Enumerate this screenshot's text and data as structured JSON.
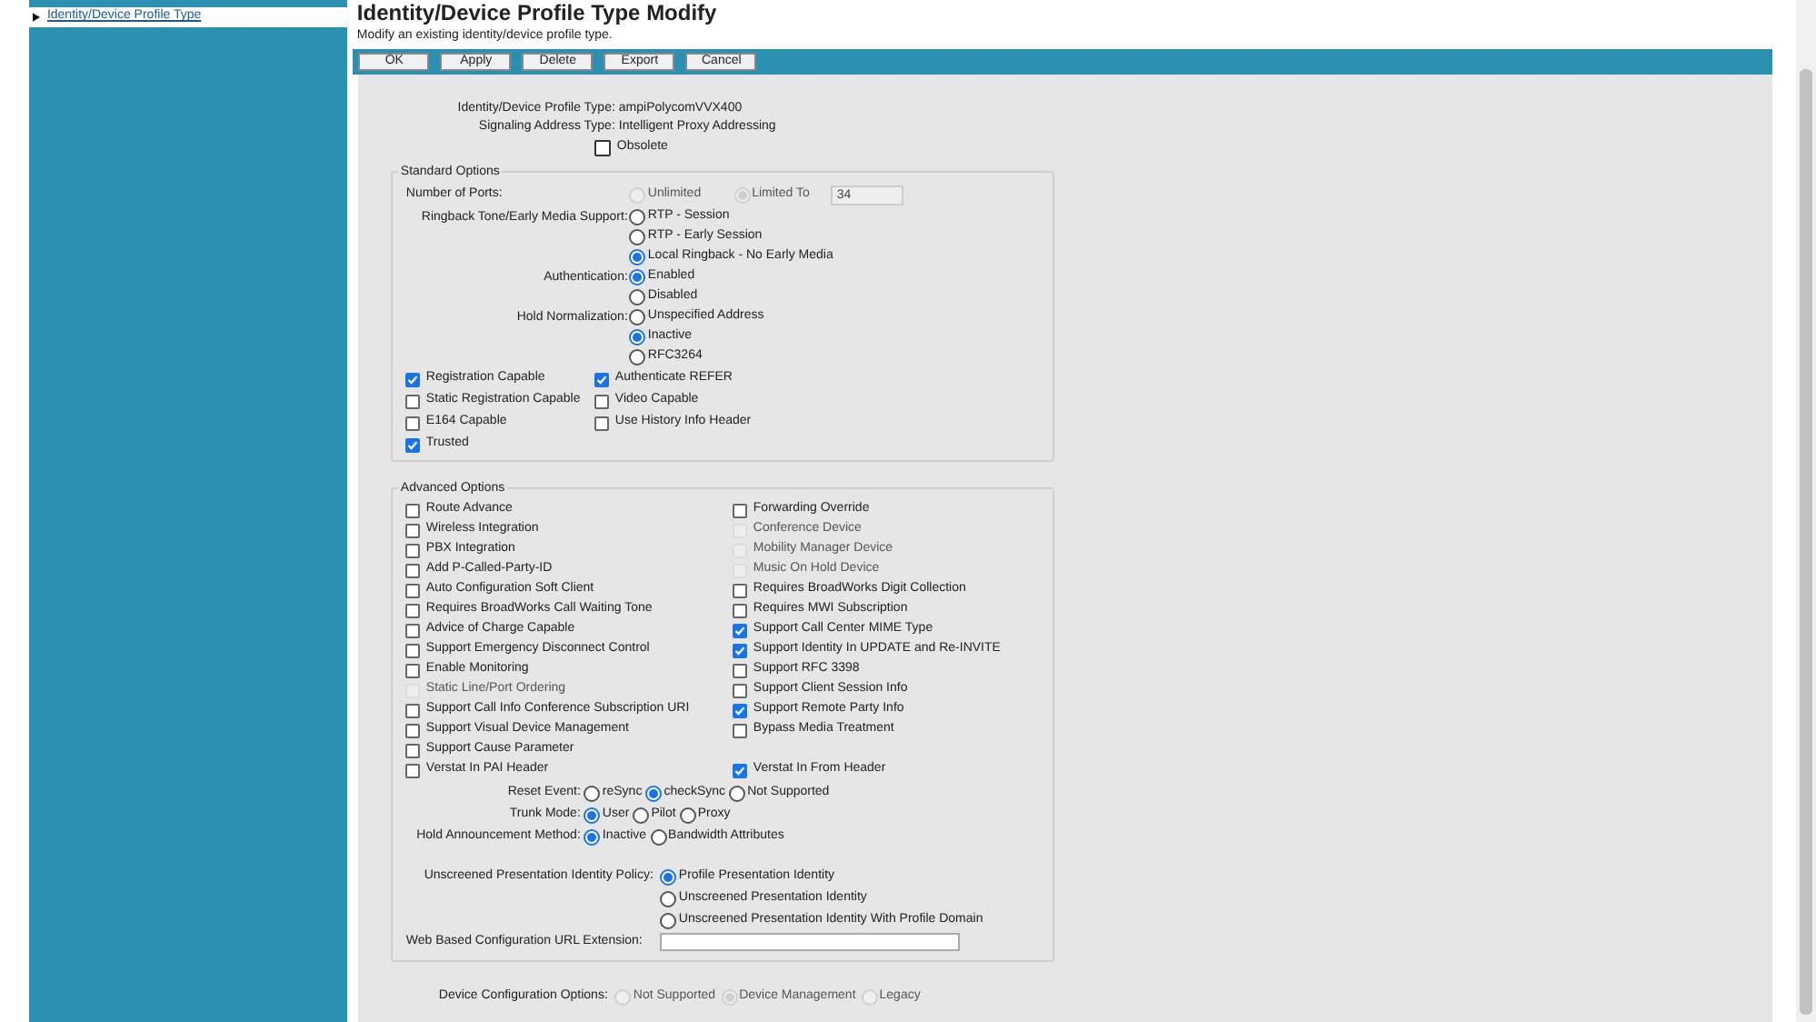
{
  "sidebar": {
    "items": [
      {
        "label": "Identity/Device Profile Type",
        "selected": true
      }
    ]
  },
  "page": {
    "title": "Identity/Device Profile Type Modify",
    "subtitle": "Modify an existing identity/device profile type."
  },
  "toolbar": {
    "buttons": [
      "OK",
      "Apply",
      "Delete",
      "Export",
      "Cancel"
    ]
  },
  "info": {
    "rows": [
      {
        "label": "Identity/Device Profile Type:",
        "value": "ampiPolycomVVX400"
      },
      {
        "label": "Signaling Address Type:",
        "value": "Intelligent Proxy Addressing"
      }
    ],
    "obsolete": {
      "label": "Obsolete",
      "checked": false
    }
  },
  "standard_options": {
    "legend": "Standard Options",
    "number_of_ports": {
      "label": "Number of Ports:",
      "options": [
        {
          "label": "Unlimited",
          "selected": false,
          "disabled": true
        },
        {
          "label": "Limited To",
          "selected": true,
          "disabled": true
        }
      ],
      "value": "34"
    },
    "radio_groups": [
      {
        "label": "Ringback Tone/Early Media Support:",
        "options": [
          {
            "label": "RTP - Session",
            "selected": false
          },
          {
            "label": "RTP - Early Session",
            "selected": false
          },
          {
            "label": "Local Ringback - No Early Media",
            "selected": true
          }
        ]
      },
      {
        "label": "Authentication:",
        "options": [
          {
            "label": "Enabled",
            "selected": true
          },
          {
            "label": "Disabled",
            "selected": false
          }
        ]
      },
      {
        "label": "Hold Normalization:",
        "options": [
          {
            "label": "Unspecified Address",
            "selected": false
          },
          {
            "label": "Inactive",
            "selected": true
          },
          {
            "label": "RFC3264",
            "selected": false
          }
        ]
      }
    ],
    "checkbox_columns": [
      [
        {
          "label": "Registration Capable",
          "checked": true
        },
        {
          "label": "Static Registration Capable",
          "checked": false
        },
        {
          "label": "E164 Capable",
          "checked": false
        },
        {
          "label": "Trusted",
          "checked": true
        }
      ],
      [
        {
          "label": "Authenticate REFER",
          "checked": true
        },
        {
          "label": "Video Capable",
          "checked": false
        },
        {
          "label": "Use History Info Header",
          "checked": false
        }
      ]
    ]
  },
  "advanced_options": {
    "legend": "Advanced Options",
    "checkbox_columns": [
      [
        {
          "label": "Route Advance",
          "checked": false,
          "disabled": false
        },
        {
          "label": "Wireless Integration",
          "checked": false,
          "disabled": false
        },
        {
          "label": "PBX Integration",
          "checked": false,
          "disabled": false
        },
        {
          "label": "Add P-Called-Party-ID",
          "checked": false,
          "disabled": false
        },
        {
          "label": "Auto Configuration Soft Client",
          "checked": false,
          "disabled": false
        },
        {
          "label": "Requires BroadWorks Call Waiting Tone",
          "checked": false,
          "disabled": false
        },
        {
          "label": "Advice of Charge Capable",
          "checked": false,
          "disabled": false
        },
        {
          "label": "Support Emergency Disconnect Control",
          "checked": false,
          "disabled": false
        },
        {
          "label": "Enable Monitoring",
          "checked": false,
          "disabled": false
        },
        {
          "label": "Static Line/Port Ordering",
          "checked": false,
          "disabled": true
        },
        {
          "label": "Support Call Info Conference Subscription URI",
          "checked": false,
          "disabled": false
        },
        {
          "label": "Support Visual Device Management",
          "checked": false,
          "disabled": false
        },
        {
          "label": "Support Cause Parameter",
          "checked": false,
          "disabled": false
        },
        {
          "label": "Verstat In PAI Header",
          "checked": false,
          "disabled": false
        }
      ],
      [
        {
          "label": "Forwarding Override",
          "checked": false,
          "disabled": false
        },
        {
          "label": "Conference Device",
          "checked": false,
          "disabled": true
        },
        {
          "label": "Mobility Manager Device",
          "checked": false,
          "disabled": true
        },
        {
          "label": "Music On Hold Device",
          "checked": false,
          "disabled": true
        },
        {
          "label": "Requires BroadWorks Digit Collection",
          "checked": false,
          "disabled": false
        },
        {
          "label": "Requires MWI Subscription",
          "checked": false,
          "disabled": false
        },
        {
          "label": "Support Call Center MIME Type",
          "checked": true,
          "disabled": false
        },
        {
          "label": "Support Identity In UPDATE and Re-INVITE",
          "checked": true,
          "disabled": false
        },
        {
          "label": "Support RFC 3398",
          "checked": false,
          "disabled": false
        },
        {
          "label": "Support Client Session Info",
          "checked": false,
          "disabled": false
        },
        {
          "label": "Support Remote Party Info",
          "checked": true,
          "disabled": false
        },
        {
          "label": "Bypass Media Treatment",
          "checked": false,
          "disabled": false
        },
        null,
        {
          "label": "Verstat In From Header",
          "checked": true,
          "disabled": false
        }
      ]
    ],
    "inline_radio_groups": [
      {
        "label": "Reset Event:",
        "options": [
          {
            "label": "reSync",
            "selected": false
          },
          {
            "label": "checkSync",
            "selected": true
          },
          {
            "label": "Not Supported",
            "selected": false
          }
        ]
      },
      {
        "label": "Trunk Mode:",
        "options": [
          {
            "label": "User",
            "selected": true
          },
          {
            "label": "Pilot",
            "selected": false
          },
          {
            "label": "Proxy",
            "selected": false
          }
        ]
      },
      {
        "label": "Hold Announcement Method:",
        "options": [
          {
            "label": "Inactive",
            "selected": true
          },
          {
            "label": "Bandwidth Attributes",
            "selected": false
          }
        ]
      }
    ],
    "presentation_policy": {
      "label": "Unscreened Presentation Identity Policy:",
      "options": [
        {
          "label": "Profile Presentation Identity",
          "selected": true
        },
        {
          "label": "Unscreened Presentation Identity",
          "selected": false
        },
        {
          "label": "Unscreened Presentation Identity With Profile Domain",
          "selected": false
        }
      ]
    },
    "url_extension": {
      "label": "Web Based Configuration URL Extension:"
    }
  },
  "device_configuration": {
    "label": "Device Configuration Options:",
    "options": [
      {
        "label": "Not Supported",
        "selected": false,
        "disabled": true
      },
      {
        "label": "Device Management",
        "selected": true,
        "disabled": true
      },
      {
        "label": "Legacy",
        "selected": false,
        "disabled": true
      }
    ]
  }
}
